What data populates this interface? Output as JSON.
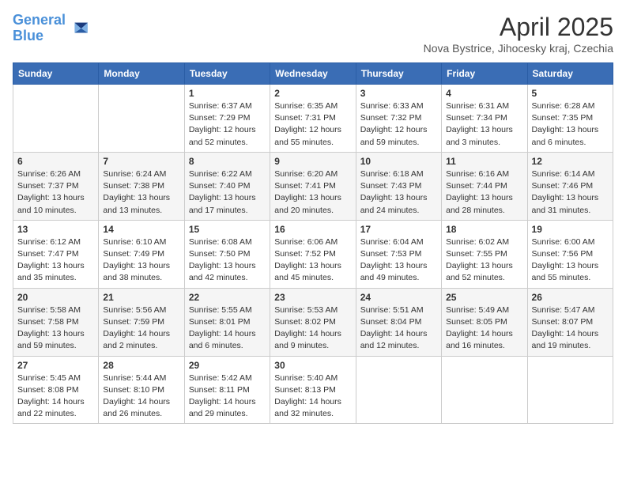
{
  "header": {
    "logo_line1": "General",
    "logo_line2": "Blue",
    "month_year": "April 2025",
    "location": "Nova Bystrice, Jihocesky kraj, Czechia"
  },
  "days_of_week": [
    "Sunday",
    "Monday",
    "Tuesday",
    "Wednesday",
    "Thursday",
    "Friday",
    "Saturday"
  ],
  "weeks": [
    [
      {
        "day": "",
        "detail": ""
      },
      {
        "day": "",
        "detail": ""
      },
      {
        "day": "1",
        "detail": "Sunrise: 6:37 AM\nSunset: 7:29 PM\nDaylight: 12 hours and 52 minutes."
      },
      {
        "day": "2",
        "detail": "Sunrise: 6:35 AM\nSunset: 7:31 PM\nDaylight: 12 hours and 55 minutes."
      },
      {
        "day": "3",
        "detail": "Sunrise: 6:33 AM\nSunset: 7:32 PM\nDaylight: 12 hours and 59 minutes."
      },
      {
        "day": "4",
        "detail": "Sunrise: 6:31 AM\nSunset: 7:34 PM\nDaylight: 13 hours and 3 minutes."
      },
      {
        "day": "5",
        "detail": "Sunrise: 6:28 AM\nSunset: 7:35 PM\nDaylight: 13 hours and 6 minutes."
      }
    ],
    [
      {
        "day": "6",
        "detail": "Sunrise: 6:26 AM\nSunset: 7:37 PM\nDaylight: 13 hours and 10 minutes."
      },
      {
        "day": "7",
        "detail": "Sunrise: 6:24 AM\nSunset: 7:38 PM\nDaylight: 13 hours and 13 minutes."
      },
      {
        "day": "8",
        "detail": "Sunrise: 6:22 AM\nSunset: 7:40 PM\nDaylight: 13 hours and 17 minutes."
      },
      {
        "day": "9",
        "detail": "Sunrise: 6:20 AM\nSunset: 7:41 PM\nDaylight: 13 hours and 20 minutes."
      },
      {
        "day": "10",
        "detail": "Sunrise: 6:18 AM\nSunset: 7:43 PM\nDaylight: 13 hours and 24 minutes."
      },
      {
        "day": "11",
        "detail": "Sunrise: 6:16 AM\nSunset: 7:44 PM\nDaylight: 13 hours and 28 minutes."
      },
      {
        "day": "12",
        "detail": "Sunrise: 6:14 AM\nSunset: 7:46 PM\nDaylight: 13 hours and 31 minutes."
      }
    ],
    [
      {
        "day": "13",
        "detail": "Sunrise: 6:12 AM\nSunset: 7:47 PM\nDaylight: 13 hours and 35 minutes."
      },
      {
        "day": "14",
        "detail": "Sunrise: 6:10 AM\nSunset: 7:49 PM\nDaylight: 13 hours and 38 minutes."
      },
      {
        "day": "15",
        "detail": "Sunrise: 6:08 AM\nSunset: 7:50 PM\nDaylight: 13 hours and 42 minutes."
      },
      {
        "day": "16",
        "detail": "Sunrise: 6:06 AM\nSunset: 7:52 PM\nDaylight: 13 hours and 45 minutes."
      },
      {
        "day": "17",
        "detail": "Sunrise: 6:04 AM\nSunset: 7:53 PM\nDaylight: 13 hours and 49 minutes."
      },
      {
        "day": "18",
        "detail": "Sunrise: 6:02 AM\nSunset: 7:55 PM\nDaylight: 13 hours and 52 minutes."
      },
      {
        "day": "19",
        "detail": "Sunrise: 6:00 AM\nSunset: 7:56 PM\nDaylight: 13 hours and 55 minutes."
      }
    ],
    [
      {
        "day": "20",
        "detail": "Sunrise: 5:58 AM\nSunset: 7:58 PM\nDaylight: 13 hours and 59 minutes."
      },
      {
        "day": "21",
        "detail": "Sunrise: 5:56 AM\nSunset: 7:59 PM\nDaylight: 14 hours and 2 minutes."
      },
      {
        "day": "22",
        "detail": "Sunrise: 5:55 AM\nSunset: 8:01 PM\nDaylight: 14 hours and 6 minutes."
      },
      {
        "day": "23",
        "detail": "Sunrise: 5:53 AM\nSunset: 8:02 PM\nDaylight: 14 hours and 9 minutes."
      },
      {
        "day": "24",
        "detail": "Sunrise: 5:51 AM\nSunset: 8:04 PM\nDaylight: 14 hours and 12 minutes."
      },
      {
        "day": "25",
        "detail": "Sunrise: 5:49 AM\nSunset: 8:05 PM\nDaylight: 14 hours and 16 minutes."
      },
      {
        "day": "26",
        "detail": "Sunrise: 5:47 AM\nSunset: 8:07 PM\nDaylight: 14 hours and 19 minutes."
      }
    ],
    [
      {
        "day": "27",
        "detail": "Sunrise: 5:45 AM\nSunset: 8:08 PM\nDaylight: 14 hours and 22 minutes."
      },
      {
        "day": "28",
        "detail": "Sunrise: 5:44 AM\nSunset: 8:10 PM\nDaylight: 14 hours and 26 minutes."
      },
      {
        "day": "29",
        "detail": "Sunrise: 5:42 AM\nSunset: 8:11 PM\nDaylight: 14 hours and 29 minutes."
      },
      {
        "day": "30",
        "detail": "Sunrise: 5:40 AM\nSunset: 8:13 PM\nDaylight: 14 hours and 32 minutes."
      },
      {
        "day": "",
        "detail": ""
      },
      {
        "day": "",
        "detail": ""
      },
      {
        "day": "",
        "detail": ""
      }
    ]
  ]
}
